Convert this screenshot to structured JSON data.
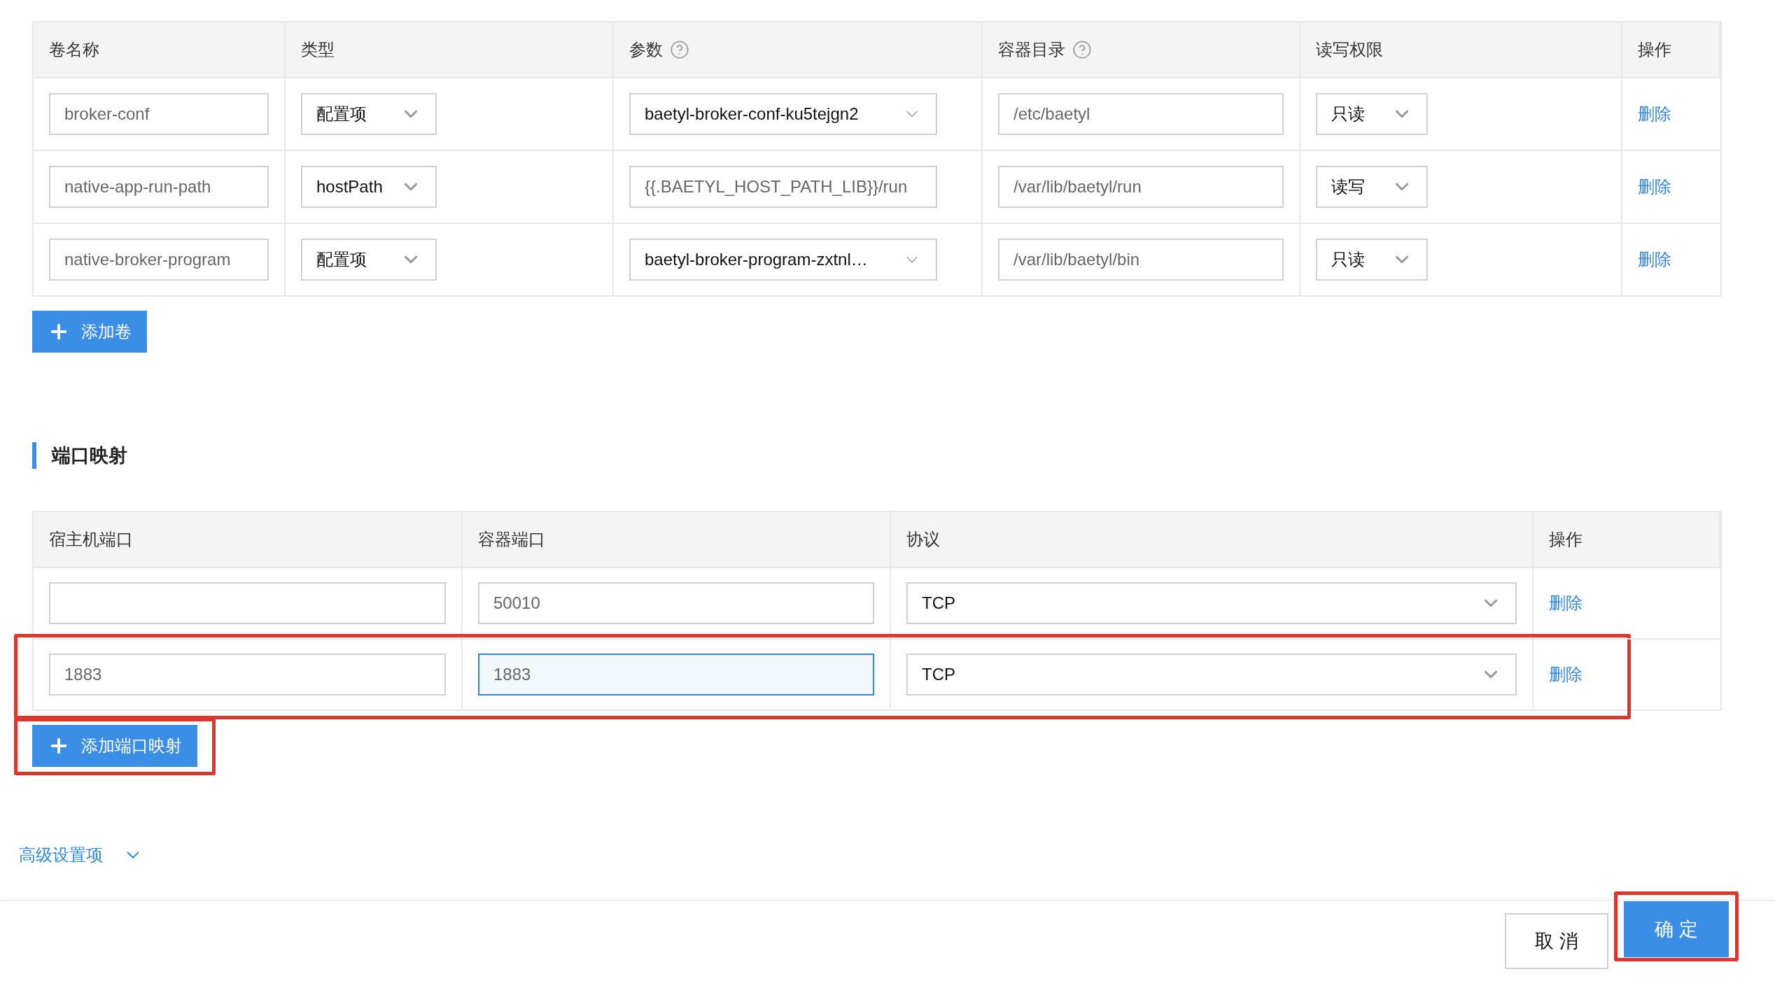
{
  "volumes": {
    "columns": [
      {
        "label": "卷名称",
        "help": false
      },
      {
        "label": "类型",
        "help": false
      },
      {
        "label": "参数",
        "help": true
      },
      {
        "label": "容器目录",
        "help": true
      },
      {
        "label": "读写权限",
        "help": false
      },
      {
        "label": "操作",
        "help": false
      }
    ],
    "rows": [
      {
        "name": "broker-conf",
        "type": "配置项",
        "param": {
          "kind": "select",
          "value": "baetyl-broker-conf-ku5tejgn2"
        },
        "path": "/etc/baetyl",
        "access": "只读",
        "action": "删除"
      },
      {
        "name": "native-app-run-path",
        "type": "hostPath",
        "param": {
          "kind": "input",
          "value": "{{.BAETYL_HOST_PATH_LIB}}/run"
        },
        "path": "/var/lib/baetyl/run",
        "access": "读写",
        "action": "删除"
      },
      {
        "name": "native-broker-program",
        "type": "配置项",
        "param": {
          "kind": "select",
          "value": "baetyl-broker-program-zxtnl…"
        },
        "path": "/var/lib/baetyl/bin",
        "access": "只读",
        "action": "删除"
      }
    ],
    "add_button": "添加卷"
  },
  "ports": {
    "title": "端口映射",
    "columns": [
      "宿主机端口",
      "容器端口",
      "协议",
      "操作"
    ],
    "rows": [
      {
        "container_port": {
          "value": "50010",
          "focused": false
        },
        "protocol": "TCP",
        "action": "删除",
        "highlighted": false
      },
      {
        "host_port": "1883",
        "container_port": {
          "value": "1883",
          "focused": true
        },
        "protocol": "TCP",
        "action": "删除",
        "highlighted": true
      }
    ],
    "add_button": {
      "label": "添加端口映射",
      "highlighted": true
    }
  },
  "advanced": {
    "label": "高级设置项",
    "expanded": false
  },
  "footer": {
    "cancel": "取 消",
    "confirm": {
      "label": "确 定",
      "highlighted": true
    }
  }
}
